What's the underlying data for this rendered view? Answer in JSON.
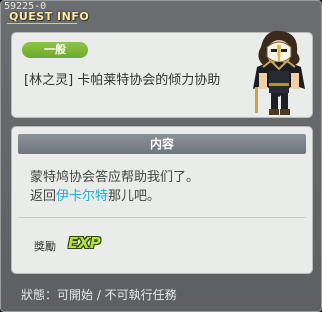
{
  "window": {
    "quest_id": "59225-0",
    "title": "QUEST INFO"
  },
  "quest": {
    "category": "一般",
    "name": "[林之灵] 卡帕莱特协会的倾力协助"
  },
  "content": {
    "header": "内容",
    "line1": "蒙特鸠协会答应帮助我们了。",
    "line2_before": "返回",
    "npc_name": "伊卡尔特",
    "line2_after": "那儿吧。"
  },
  "reward": {
    "label": "獎勵",
    "exp_label": "EXP"
  },
  "status": {
    "text": "狀態：可開始 / 不可執行任務"
  },
  "icons": {
    "npc_portrait": "masked-npc-portrait"
  }
}
